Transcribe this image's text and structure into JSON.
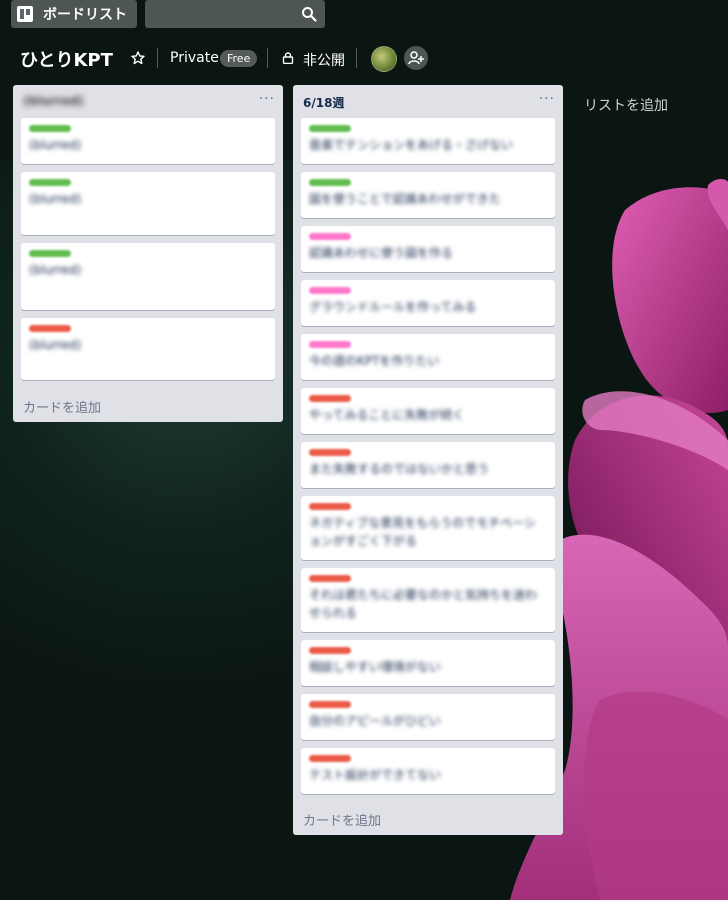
{
  "topbar": {
    "boards_label": "ボードリスト",
    "search_value": ""
  },
  "board": {
    "title": "ひとりKPT",
    "visibility_workspace": "Private",
    "plan_badge": "Free",
    "visibility": "非公開"
  },
  "lists": [
    {
      "title": "(blurred)",
      "cards": [
        {
          "label_color": "#61bd4f",
          "text": "(blurred)"
        },
        {
          "label_color": "#61bd4f",
          "text": "(blurred)"
        },
        {
          "label_color": "#61bd4f",
          "text": "(blurred)"
        },
        {
          "label_color": "#eb5a46",
          "text": "(blurred)"
        }
      ],
      "add_card": "カードを追加"
    },
    {
      "title": "6/18週",
      "cards": [
        {
          "label_color": "#61bd4f",
          "text": "音楽でテンションをあげる・さげない"
        },
        {
          "label_color": "#61bd4f",
          "text": "図を使うことで認識あわせができた"
        },
        {
          "label_color": "#ff78cb",
          "text": "認識あわせに使う図を作る"
        },
        {
          "label_color": "#ff78cb",
          "text": "グラウンドルールを作ってみる"
        },
        {
          "label_color": "#ff78cb",
          "text": "今の週のKPTを作りたい"
        },
        {
          "label_color": "#eb5a46",
          "text": "やってみることに失敗が続く"
        },
        {
          "label_color": "#eb5a46",
          "text": "また失敗するのではないかと思う"
        },
        {
          "label_color": "#eb5a46",
          "text": "ネガティブな意見をもらうのでモチベーションがすごく下がる"
        },
        {
          "label_color": "#eb5a46",
          "text": "それは君たちに必要なのかと気持ちを迷わせられる"
        },
        {
          "label_color": "#eb5a46",
          "text": "相談しやすい環境がない"
        },
        {
          "label_color": "#eb5a46",
          "text": "自分のアピールがひどい"
        },
        {
          "label_color": "#eb5a46",
          "text": "テスト設計ができてない"
        }
      ],
      "add_card": "カードを追加"
    }
  ],
  "add_list": "リストを追加",
  "icons": {
    "boards": "boards-icon",
    "search": "search-icon",
    "star": "star-icon",
    "lock": "lock-icon",
    "add_member": "add-member-icon",
    "menu": "ellipsis-icon"
  },
  "colors": {
    "green_label": "#61bd4f",
    "pink_label": "#ff78cb",
    "red_label": "#eb5a46",
    "list_bg": "#dfe1e6"
  }
}
